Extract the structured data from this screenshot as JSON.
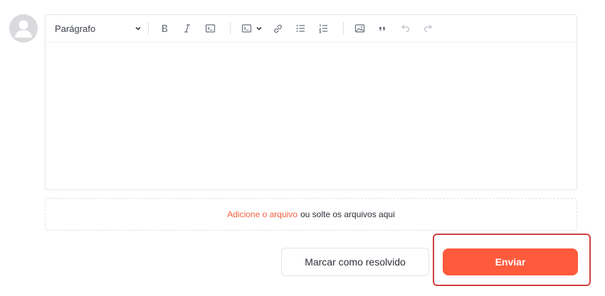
{
  "avatar": {
    "icon": "user-avatar-icon"
  },
  "toolbar": {
    "paragraph_select": "Parágrafo",
    "buttons": [
      {
        "icon": "bold-icon"
      },
      {
        "icon": "italic-icon"
      },
      {
        "icon": "code-icon"
      },
      {
        "icon": "code-block-icon"
      },
      {
        "icon": "link-icon"
      },
      {
        "icon": "bulleted-list-icon"
      },
      {
        "icon": "numbered-list-icon"
      },
      {
        "icon": "image-icon"
      },
      {
        "icon": "quote-icon"
      },
      {
        "icon": "undo-icon"
      },
      {
        "icon": "redo-icon"
      }
    ]
  },
  "dropzone": {
    "link_text": "Adicione o arquivo",
    "rest_text": "ou solte os arquivos aqui"
  },
  "actions": {
    "resolve_label": "Marcar como resolvido",
    "send_label": "Enviar"
  },
  "colors": {
    "accent": "#ff5a3c",
    "link": "#f2603f",
    "highlight_border": "#d2403f"
  }
}
